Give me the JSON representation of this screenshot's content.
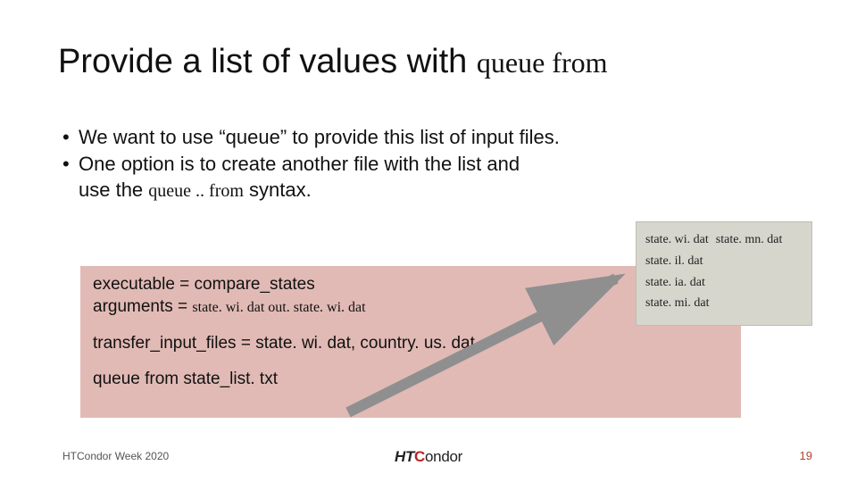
{
  "title": {
    "main": "Provide a list of values with ",
    "mono": "queue from"
  },
  "bullets": {
    "b1": "We want to use “queue” to provide this list of input files.",
    "b2": "One option is to create another file with the list and",
    "b2c": "use the ",
    "b2_mono": "queue .. from",
    "b2_tail": " syntax."
  },
  "code": {
    "l1": "executable = compare_states",
    "l2a": "arguments  = ",
    "l2b": "state. wi. dat out. state. wi. dat",
    "l3": "transfer_input_files = state. wi. dat, country. us. dat",
    "l4": "queue from state_list. txt"
  },
  "filebox": {
    "r1a": "state. wi. dat",
    "r1b": "state. mn. dat",
    "r2": "state. il. dat",
    "r3": "state. ia. dat",
    "r4": "state. mi. dat"
  },
  "footer": {
    "left": "HTCondor Week 2020",
    "page": "19",
    "logo_ht": "HT",
    "logo_c": "C",
    "logo_rest": "ondor"
  }
}
